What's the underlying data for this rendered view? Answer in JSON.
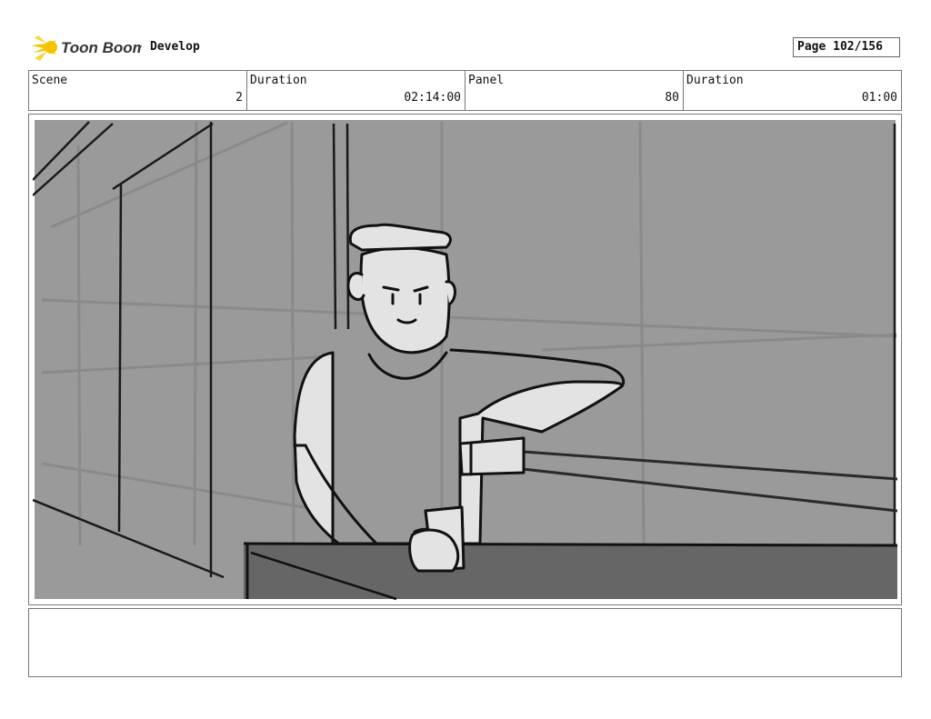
{
  "header": {
    "logo_text": "Toon Boom",
    "project": "Develop",
    "page": "Page 102/156"
  },
  "info": [
    {
      "label": "Scene",
      "value": "2"
    },
    {
      "label": "Duration",
      "value": "02:14:00"
    },
    {
      "label": "Panel",
      "value": "80"
    },
    {
      "label": "Duration",
      "value": "01:00"
    }
  ],
  "colors": {
    "sky_gray": "#9a9a9a",
    "counter_gray": "#666666",
    "character_fill": "#e3e3e3",
    "logo_yellow": "#f5c400"
  }
}
